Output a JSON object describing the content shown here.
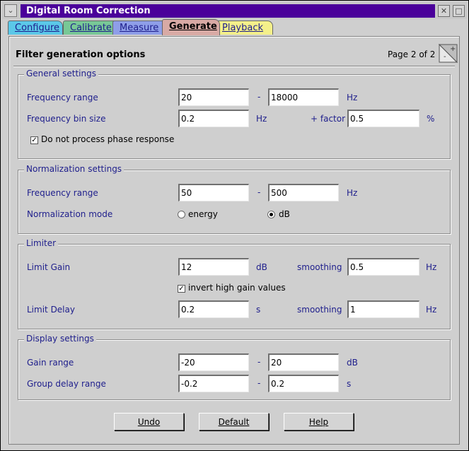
{
  "window": {
    "title": "Digital Room Correction",
    "sysmenu_glyph": "⌄",
    "close_glyph": "✕",
    "maximize_glyph": "□"
  },
  "tabs": [
    {
      "label": "Configure",
      "color": "#5bc8e8"
    },
    {
      "label": "Calibrate",
      "color": "#78c896"
    },
    {
      "label": "Measure",
      "color": "#8e9ee8"
    },
    {
      "label": "Generate",
      "color": "#d8aaa5",
      "active": true
    },
    {
      "label": "Playback",
      "color": "#f4f08a"
    }
  ],
  "panel": {
    "title": "Filter generation options",
    "page_indicator": "Page 2 of 2",
    "dogear_minus": "-",
    "dogear_plus": "+"
  },
  "general": {
    "title": "General settings",
    "freq_range_label": "Frequency range",
    "freq_min": "20",
    "range_dash": "-",
    "freq_max": "18000",
    "freq_unit": "Hz",
    "bin_size_label": "Frequency bin size",
    "bin_size": "0.2",
    "bin_unit": "Hz",
    "factor_label": "+ factor",
    "factor": "0.5",
    "factor_unit": "%",
    "phase_checkbox_label": "Do not process phase response",
    "phase_checked": true
  },
  "normalization": {
    "title": "Normalization settings",
    "freq_range_label": "Frequency range",
    "freq_min": "50",
    "range_dash": "-",
    "freq_max": "500",
    "freq_unit": "Hz",
    "mode_label": "Normalization mode",
    "mode_options": [
      "energy",
      "dB"
    ],
    "mode_selected": "dB"
  },
  "limiter": {
    "title": "Limiter",
    "gain_label": "Limit Gain",
    "gain": "12",
    "gain_unit": "dB",
    "gain_smoothing_label": "smoothing",
    "gain_smoothing": "0.5",
    "gain_smoothing_unit": "Hz",
    "invert_label": "invert high gain values",
    "invert_checked": true,
    "delay_label": "Limit Delay",
    "delay": "0.2",
    "delay_unit": "s",
    "delay_smoothing_label": "smoothing",
    "delay_smoothing": "1",
    "delay_smoothing_unit": "Hz"
  },
  "display": {
    "title": "Display settings",
    "gain_range_label": "Gain range",
    "gain_min": "-20",
    "range_dash": "-",
    "gain_max": "20",
    "gain_unit": "dB",
    "group_delay_label": "Group delay range",
    "gd_min": "-0.2",
    "gd_max": "0.2",
    "gd_unit": "s"
  },
  "buttons": {
    "undo": "Undo",
    "default": "Default",
    "help": "Help"
  }
}
